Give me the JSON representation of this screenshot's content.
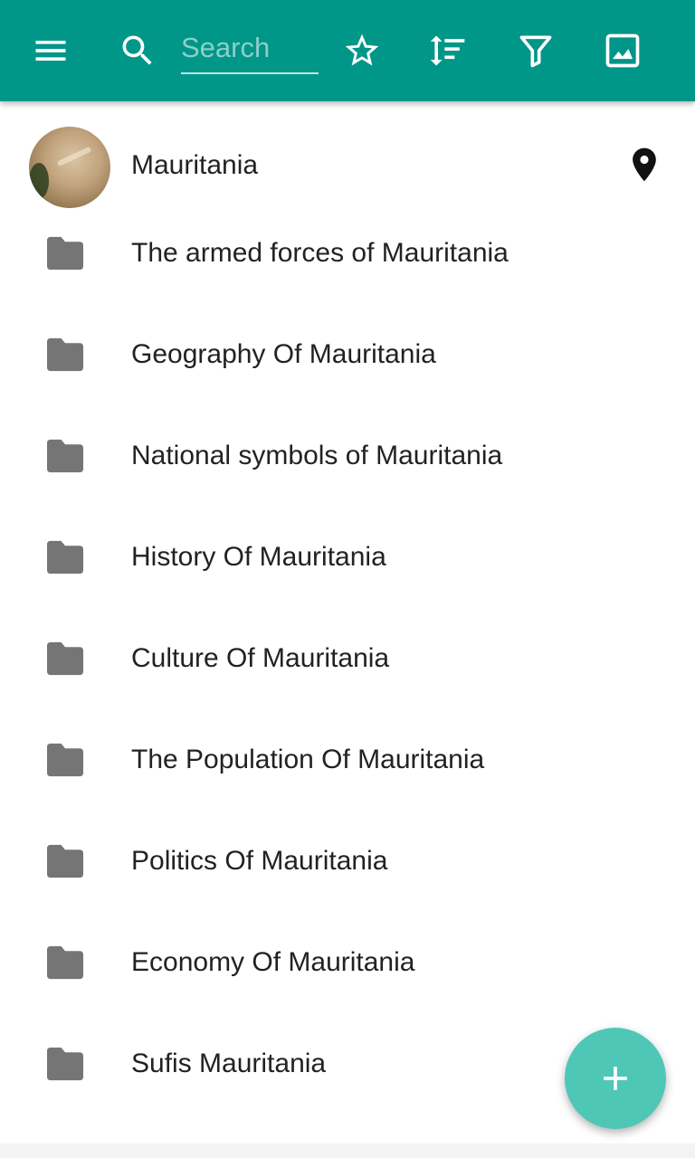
{
  "colors": {
    "toolbar": "#009688",
    "fab": "#4fc7b7",
    "folder": "#757575",
    "text": "#222222",
    "icon": "#ffffff"
  },
  "toolbar": {
    "menu_icon": "menu-icon",
    "search_icon": "search-icon",
    "search_placeholder": "Search",
    "search_value": "",
    "star_icon": "star-outline-icon",
    "sort_icon": "sort-icon",
    "filter_icon": "filter-icon",
    "image_icon": "image-icon"
  },
  "header_item": {
    "label": "Mauritania",
    "pin_icon": "map-pin-icon"
  },
  "categories": [
    {
      "label": "The armed forces of Mauritania"
    },
    {
      "label": "Geography Of Mauritania"
    },
    {
      "label": "National symbols of Mauritania"
    },
    {
      "label": "History Of Mauritania"
    },
    {
      "label": "Culture Of Mauritania"
    },
    {
      "label": "The Population Of Mauritania"
    },
    {
      "label": "Politics Of Mauritania"
    },
    {
      "label": "Economy Of Mauritania"
    },
    {
      "label": "Sufis Mauritania"
    }
  ],
  "fab": {
    "icon": "plus-icon"
  }
}
